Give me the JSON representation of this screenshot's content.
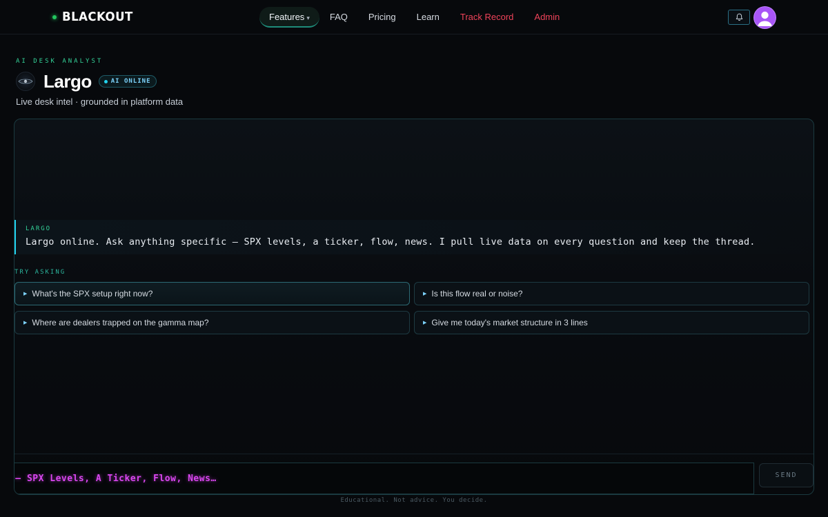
{
  "nav": {
    "brand": "BLACKOUT",
    "links": [
      {
        "label": "Features",
        "active": true,
        "caret": "▾"
      },
      {
        "label": "FAQ"
      },
      {
        "label": "Pricing"
      },
      {
        "label": "Learn"
      },
      {
        "label": "Track Record",
        "color": "#f0435a"
      },
      {
        "label": "Admin",
        "color": "#f0435a"
      }
    ],
    "icons": {
      "bell": "bell-icon",
      "avatar": "user-avatar-icon"
    }
  },
  "header": {
    "eyebrow": "AI DESK ANALYST",
    "title": "Largo",
    "status": "AI ONLINE",
    "subtitle": "Live desk intel · grounded in platform data"
  },
  "chat": {
    "messages": [
      {
        "sender": "LARGO",
        "text": "Largo online. Ask anything specific — SPX levels, a ticker, flow, news. I pull live data on every question and keep the thread."
      }
    ],
    "try_label": "TRY ASKING",
    "suggestions": [
      "What's the SPX setup right now?",
      "Is this flow real or noise?",
      "Where are dealers trapped on the gamma map?",
      "Give me today's market structure in 3 lines"
    ],
    "input_placeholder": "esk — SPX Levels, A Ticker, Flow, News…",
    "send_label": "SEND"
  },
  "footer": {
    "disclaimer": "Educational. Not advice. You decide."
  },
  "colors": {
    "accent_green": "#34d399",
    "accent_cyan": "#22d3ee",
    "alert_red": "#f0435a",
    "input_magenta": "#d946ef",
    "avatar_purple": "#a855f7"
  }
}
